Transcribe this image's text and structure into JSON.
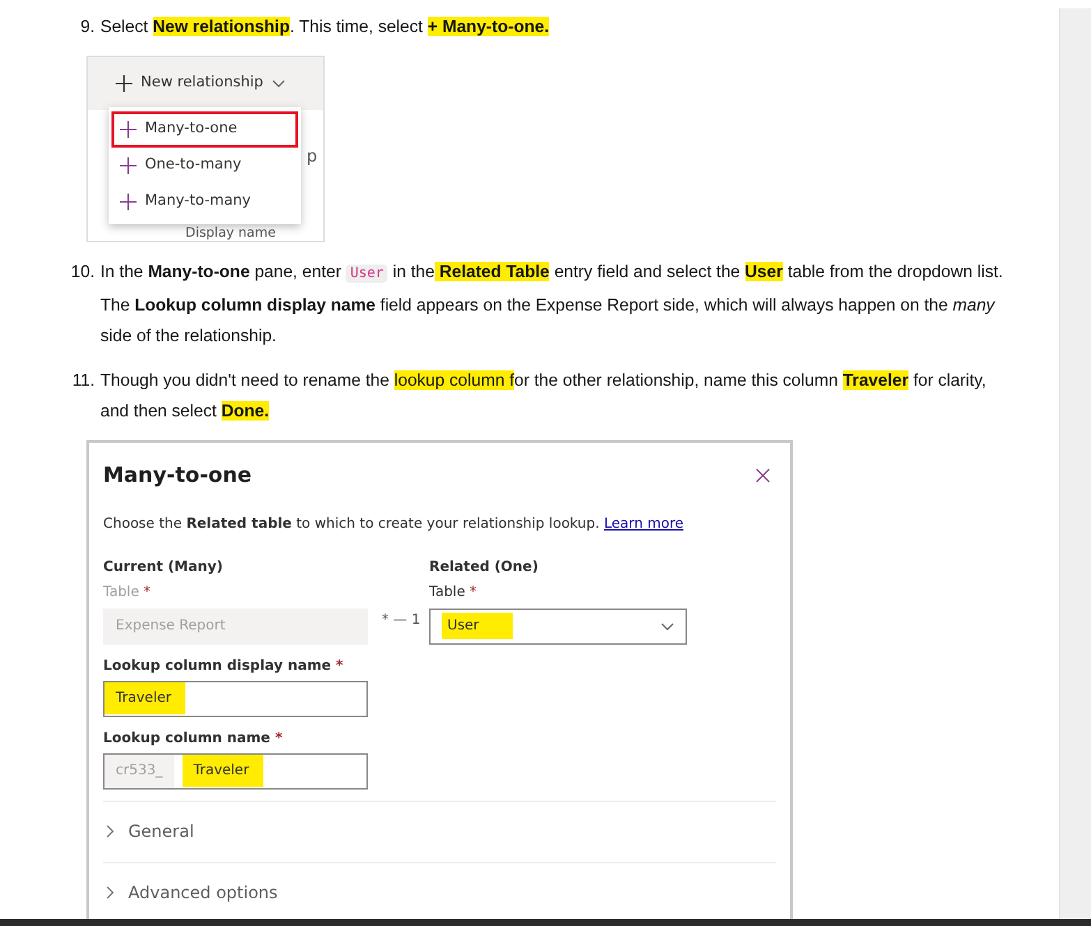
{
  "content": [
    {
      "kind": "step",
      "number": "9.",
      "segments": [
        {
          "text": "Select "
        },
        {
          "text": "New relationship",
          "bold": true,
          "highlighted": true
        },
        {
          "text": ". This time, select "
        },
        {
          "text": "+ Many-to-one.",
          "bold": true,
          "highlighted": true
        }
      ]
    },
    {
      "kind": "menu_screenshot",
      "button": "New relationship",
      "items": [
        {
          "label": "Many-to-one",
          "selected": true
        },
        {
          "label": "One-to-many",
          "selected": false
        },
        {
          "label": "Many-to-many",
          "selected": false
        }
      ],
      "behind_text_1": "p",
      "behind_text_2": "Display name"
    },
    {
      "kind": "step",
      "number": "10.",
      "segments": [
        {
          "text": "In the "
        },
        {
          "text": "Many-to-one",
          "bold": true
        },
        {
          "text": " pane, enter "
        },
        {
          "text": "User",
          "code": true
        },
        {
          "text": " in the"
        },
        {
          "text": " Related Table",
          "bold": true,
          "highlighted": true
        },
        {
          "text": " entry field and select the "
        },
        {
          "text": "User",
          "bold": true,
          "highlighted": true
        },
        {
          "text": " table from the dropdown list. The "
        },
        {
          "text": "Lookup column display name",
          "bold": true
        },
        {
          "text": " field appears on the Expense Report side, which will always happen on the "
        },
        {
          "text": "many",
          "italic": true
        },
        {
          "text": " side of the relationship."
        }
      ]
    },
    {
      "kind": "step",
      "number": "11.",
      "segments": [
        {
          "text": "Though you didn't need to rename the "
        },
        {
          "text": "lookup column f",
          "highlighted": true
        },
        {
          "text": "or the other relationship, name this colum"
        },
        {
          "text": "n "
        },
        {
          "text": "Traveler",
          "bold": true,
          "highlighted": true
        },
        {
          "text": " for clarity, and then selec"
        },
        {
          "text": "t "
        },
        {
          "text": "Done.",
          "bold": true,
          "highlighted": true
        }
      ]
    },
    {
      "kind": "dialog_screenshot",
      "title": "Many-to-one",
      "description": [
        {
          "text": "Choose the "
        },
        {
          "text": "Related table",
          "bold": true
        },
        {
          "text": " to which to create your relationship lookup. "
        },
        {
          "text": "Learn more",
          "link": true
        }
      ],
      "current": {
        "heading": "Current (Many)",
        "table_label": "Table",
        "required": "*",
        "table_value": "Expense Report",
        "disabled": true
      },
      "connector": "* — 1",
      "related": {
        "heading": "Related (One)",
        "table_label": "Table",
        "required": "*",
        "table_value": "User",
        "highlighted": true
      },
      "display_name": {
        "label": "Lookup column display name",
        "required": "*",
        "value": "Traveler",
        "highlighted": true
      },
      "column_name": {
        "label": "Lookup column name",
        "required": "*",
        "prefix": "cr533_",
        "value": "Traveler",
        "highlighted": true
      },
      "sections": [
        {
          "label": "General",
          "expanded": false
        },
        {
          "label": "Advanced options",
          "expanded": false
        }
      ]
    }
  ]
}
